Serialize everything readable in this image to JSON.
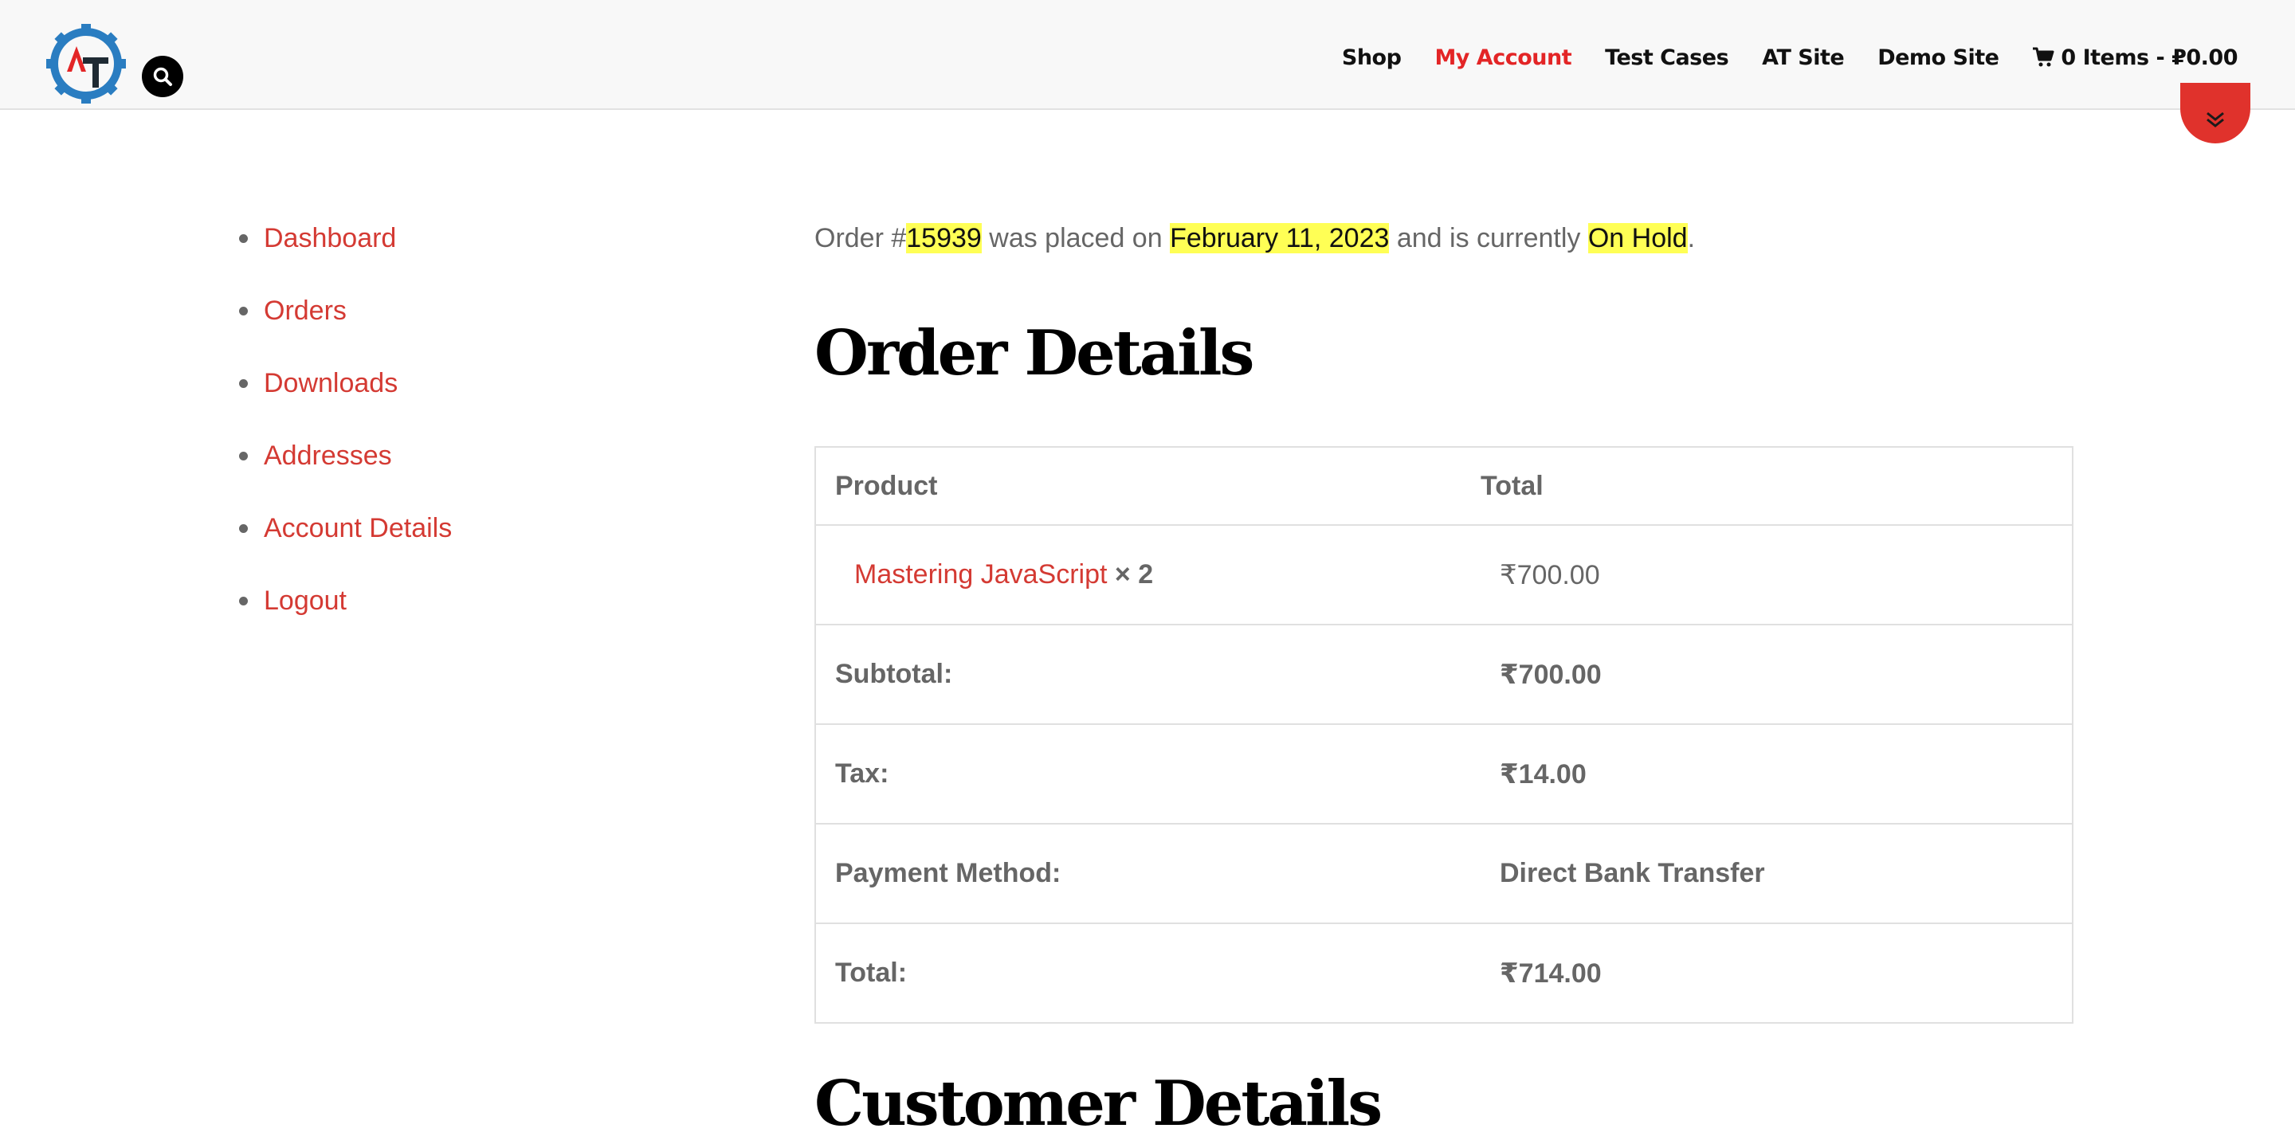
{
  "header": {
    "nav": [
      {
        "label": "Shop"
      },
      {
        "label": "My Account"
      },
      {
        "label": "Test Cases"
      },
      {
        "label": "AT Site"
      },
      {
        "label": "Demo Site"
      }
    ],
    "cart_label": "0 Items - ₽0.00",
    "active_color": "#e32526",
    "accent_color": "#e0322c"
  },
  "sidebar": {
    "items": [
      {
        "label": "Dashboard"
      },
      {
        "label": "Orders"
      },
      {
        "label": "Downloads"
      },
      {
        "label": "Addresses"
      },
      {
        "label": "Account Details"
      },
      {
        "label": "Logout"
      }
    ]
  },
  "order": {
    "prefix": "Order #",
    "number": "15939",
    "placed_text": " was placed on ",
    "date": "February 11, 2023",
    "status_text": " and is currently ",
    "status": "On Hold",
    "suffix": "."
  },
  "details": {
    "title": "Order Details",
    "headers": {
      "product": "Product",
      "total": "Total"
    },
    "item": {
      "name": "Mastering JavaScript",
      "qty": "× 2",
      "total": "₹700.00"
    },
    "rows": [
      {
        "label": "Subtotal:",
        "value": "₹700.00"
      },
      {
        "label": "Tax:",
        "value": "₹14.00"
      },
      {
        "label": "Payment Method:",
        "value": "Direct Bank Transfer"
      },
      {
        "label": "Total:",
        "value": "₹714.00"
      }
    ]
  },
  "customer": {
    "title": "Customer Details"
  }
}
